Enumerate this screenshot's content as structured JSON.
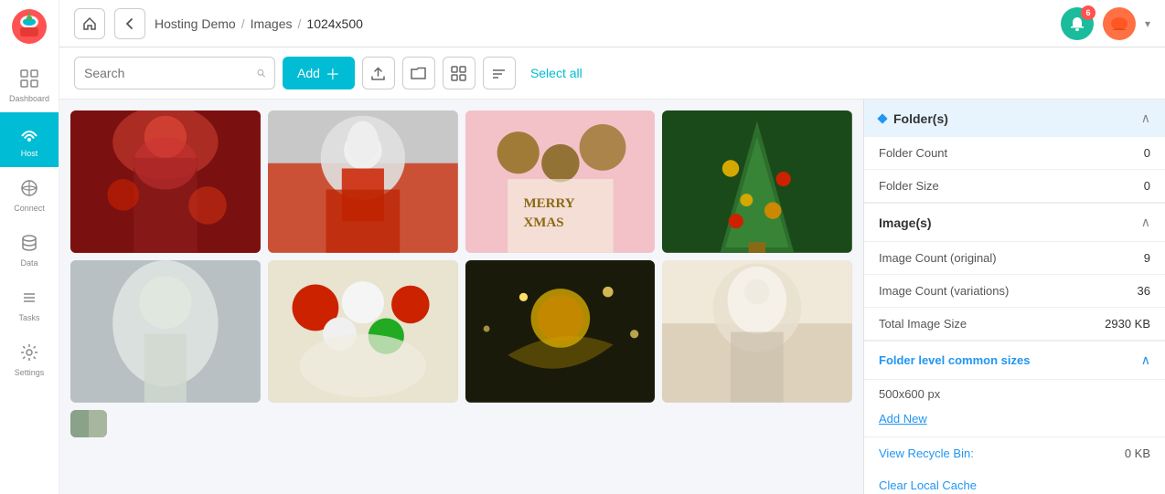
{
  "app": {
    "title": "Hosting Demo",
    "breadcrumb": [
      "Hosting Demo",
      "Images",
      "1024x500"
    ]
  },
  "notification_count": "6",
  "sidebar": {
    "items": [
      {
        "id": "dashboard",
        "label": "Dashboard",
        "icon": "⊞"
      },
      {
        "id": "host",
        "label": "Host",
        "icon": "☁",
        "active": true
      },
      {
        "id": "connect",
        "label": "Connect",
        "icon": "📡"
      },
      {
        "id": "data",
        "label": "Data",
        "icon": "🗄"
      },
      {
        "id": "tasks",
        "label": "Tasks",
        "icon": "☰"
      },
      {
        "id": "settings",
        "label": "Settings",
        "icon": "⚙"
      }
    ]
  },
  "toolbar": {
    "search_placeholder": "Search",
    "add_label": "Add",
    "select_all_label": "Select all"
  },
  "folders_section": {
    "title": "Folder(s)",
    "folder_count_label": "Folder Count",
    "folder_count_value": "0",
    "folder_size_label": "Folder Size",
    "folder_size_value": "0"
  },
  "images_section": {
    "title": "Image(s)",
    "image_count_original_label": "Image Count (original)",
    "image_count_original_value": "9",
    "image_count_variations_label": "Image Count (variations)",
    "image_count_variations_value": "36",
    "total_size_label": "Total Image Size",
    "total_size_value": "2930 KB"
  },
  "folder_sizes_section": {
    "title": "Folder level common sizes",
    "size_entry": "500x600 px",
    "add_new_label": "Add New"
  },
  "recycle_bin": {
    "label": "View Recycle Bin:",
    "value": "0 KB"
  },
  "clear_cache": {
    "label": "Clear Local Cache"
  }
}
